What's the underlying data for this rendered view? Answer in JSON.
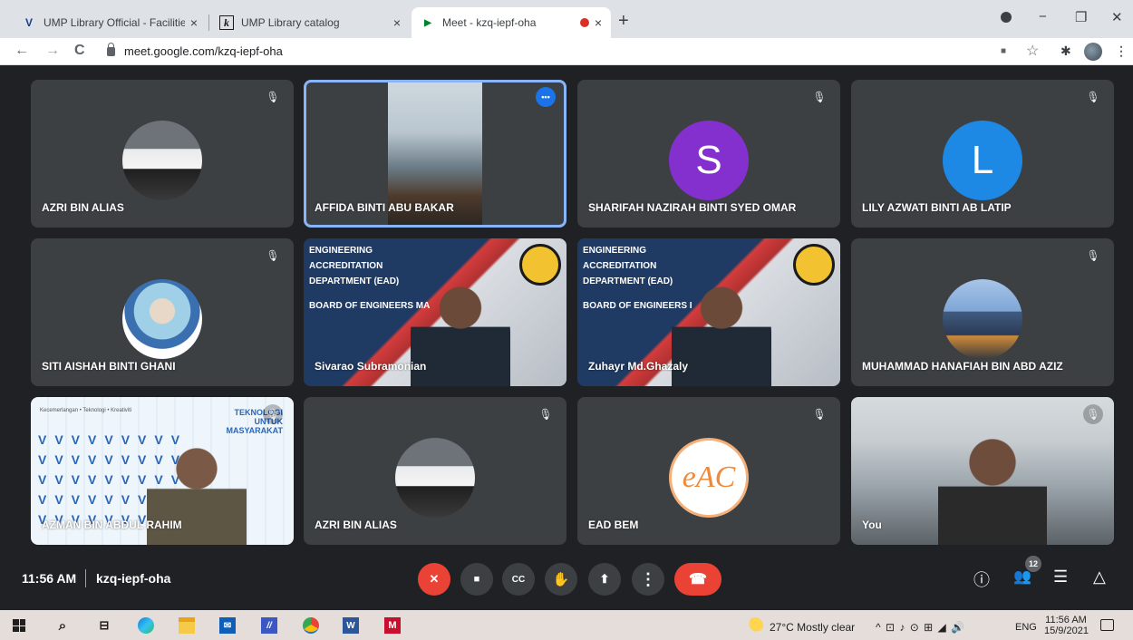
{
  "browser": {
    "tabs": [
      {
        "title": "UMP Library Official - Facilities",
        "favicon": "V",
        "close": "×"
      },
      {
        "title": "UMP Library catalog",
        "favicon": "k",
        "close": "×"
      },
      {
        "title": "Meet - kzq-iepf-oha",
        "favicon": "▶",
        "close": "×"
      }
    ],
    "new_tab": "+",
    "address": "meet.google.com/kzq-iepf-oha",
    "nav": {
      "back": "←",
      "forward": "→",
      "reload": "C"
    },
    "window": {
      "minimize": "−",
      "restore": "❐",
      "close": "✕"
    },
    "ext": {
      "camera": "■",
      "star": "☆",
      "puzzle": "✱",
      "menu": "⋮"
    },
    "colors": {
      "meet_bg": "#202124",
      "tile_bg": "#3c4043",
      "accent": "#8ab4f8",
      "danger": "#ea4335"
    }
  },
  "meet": {
    "participants": [
      {
        "name": "AZRI BIN ALIAS",
        "avatar": "car"
      },
      {
        "name": "AFFIDA BINTI ABU BAKAR",
        "avatar": "video"
      },
      {
        "name": "SHARIFAH NAZIRAH BINTI SYED OMAR",
        "initial": "S",
        "color": "#8430ce"
      },
      {
        "name": "LILY AZWATI BINTI AB LATIP",
        "initial": "L",
        "color": "#1e88e5"
      },
      {
        "name": "SITI AISHAH BINTI GHANI",
        "avatar": "hijab"
      },
      {
        "name": "Sivarao Subramonian",
        "avatar": "video"
      },
      {
        "name": "Zuhayr Md.Ghazaly",
        "avatar": "video"
      },
      {
        "name": "MUHAMMAD HANAFIAH BIN ABD AZIZ",
        "avatar": "mosque"
      },
      {
        "name": "AZMAN BIN ABDUL RAHIM",
        "avatar": "video"
      },
      {
        "name": "AZRI BIN ALIAS",
        "avatar": "car"
      },
      {
        "name": "EAD BEM",
        "avatar": "eAC"
      },
      {
        "name": "You",
        "avatar": "video"
      }
    ],
    "ead_slide": {
      "line1": "ENGINEERING",
      "line2": "ACCREDITATION",
      "line3": "DEPARTMENT (EAD)",
      "board": "BOARD OF ENGINEERS MA",
      "board2": "BOARD OF ENGINEERS I"
    },
    "teknologi": {
      "title": "TEKNOLOGI\nUNTUK\nMASYARAKAT",
      "tag": "Kecemerlangan • Teknologi • Kreativiti"
    },
    "more_icon": "•••",
    "mic_off_icon": "🎙",
    "eac_logo": "eAC",
    "bottom": {
      "time": "11:56 AM",
      "code": "kzq-iepf-oha",
      "people_count": "12"
    },
    "controls": {
      "mic": "✕",
      "cam": "■",
      "cc": "CC",
      "hand": "✋",
      "present": "⬆",
      "more": "⋮",
      "hang": "☎"
    },
    "right_icons": {
      "info": "ⓘ",
      "people": "👥",
      "chat": "☰",
      "activities": "△"
    }
  },
  "taskbar": {
    "weather": "27°C  Mostly clear",
    "lang": "ENG",
    "time": "11:56 AM",
    "date": "15/9/2021",
    "tray": "^  ⊡  ♪  ⊙  ⊞  ◢  🔊"
  }
}
